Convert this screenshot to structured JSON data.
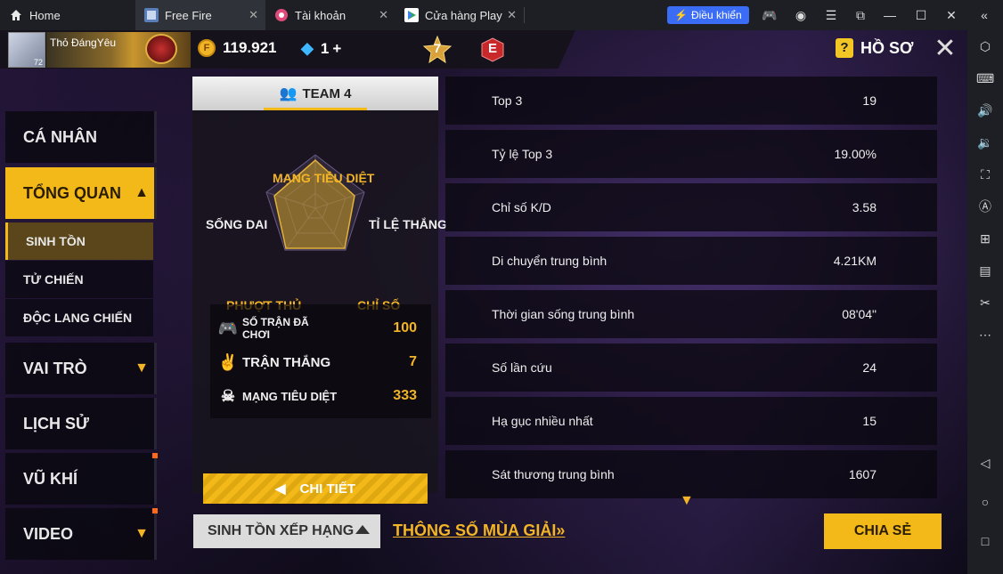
{
  "emulator": {
    "tabs": [
      {
        "label": "Home",
        "icon": "home-icon"
      },
      {
        "label": "Free Fire",
        "icon": "free-fire-app-icon",
        "active": true
      },
      {
        "label": "Tài khoản",
        "icon": "account-app-icon"
      },
      {
        "label": "Cửa hàng Play",
        "icon": "play-store-icon"
      }
    ],
    "control_button": "Điều khiển"
  },
  "header": {
    "player_name": "Thỏ ĐángYêu",
    "player_level": "72",
    "coins": "119.921",
    "diamonds": "1",
    "rank_number": "7",
    "rank_letter": "E",
    "profile_title": "HỒ SƠ"
  },
  "nav": {
    "items": [
      {
        "label": "CÁ NHÂN"
      },
      {
        "label": "TỔNG QUAN"
      },
      {
        "label": "VAI TRÒ"
      },
      {
        "label": "LỊCH SỬ"
      },
      {
        "label": "VŨ KHÍ"
      },
      {
        "label": "VIDEO"
      }
    ],
    "sub_items": [
      {
        "label": "SINH TỒN"
      },
      {
        "label": "TỬ CHIẾN"
      },
      {
        "label": "ĐỘC LANG CHIẾN"
      }
    ]
  },
  "team_panel": {
    "title": "TEAM 4",
    "radar_labels": {
      "top": "MẠNG TIÊU DIỆT",
      "right": "TỈ LỆ THẮNG",
      "bottom_right": "CHỈ SỐ",
      "bottom_left": "PHƯỢT THỦ",
      "left": "SỐNG DAI"
    },
    "stats": [
      {
        "label": "SỐ TRẬN ĐÃ CHƠI",
        "value": "100",
        "icon": "gamepad-icon"
      },
      {
        "label": "TRẬN THẮNG",
        "value": "7",
        "icon": "victory-hand-icon"
      },
      {
        "label": "MẠNG TIÊU DIỆT",
        "value": "333",
        "icon": "skull-icon"
      }
    ],
    "details_button": "CHI TIẾT"
  },
  "stats_rows": [
    {
      "label": "Top 3",
      "value": "19"
    },
    {
      "label": "Tỷ lệ Top 3",
      "value": "19.00%"
    },
    {
      "label": "Chỉ số K/D",
      "value": "3.58"
    },
    {
      "label": "Di chuyển trung bình",
      "value": "4.21KM"
    },
    {
      "label": "Thời gian sống trung bình",
      "value": "08'04\""
    },
    {
      "label": "Số lần cứu",
      "value": "24"
    },
    {
      "label": "Hạ gục nhiều nhất",
      "value": "15"
    },
    {
      "label": "Sát thương trung bình",
      "value": "1607"
    }
  ],
  "bottom": {
    "mode_select": "SINH TỒN XẾP HẠNG",
    "season_link": "THÔNG SỐ MÙA GIẢI",
    "season_link_suffix": "»",
    "share_button": "CHIA SẺ"
  },
  "colors": {
    "accent": "#f2b918",
    "panel": "#15121c",
    "value_text": "#f3b526"
  }
}
